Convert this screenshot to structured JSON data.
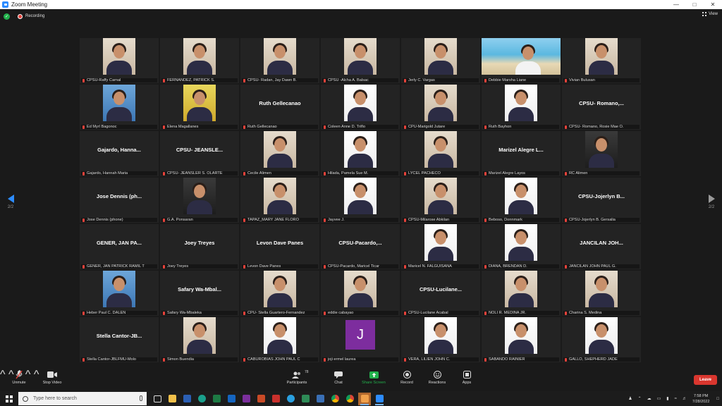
{
  "window": {
    "title": "Zoom Meeting"
  },
  "topbar": {
    "recording_label": "Recording",
    "view_label": "View"
  },
  "pager": {
    "left_label": "2/2",
    "right_label": "2/2"
  },
  "participants": [
    {
      "label": "CPSU-Raffy Carnal",
      "name_display": "",
      "video": "photo"
    },
    {
      "label": "FERNANDEZ, PATRICK S.",
      "name_display": "",
      "video": "photo"
    },
    {
      "label": "CPSU- Radan, Jay Dawn B.",
      "name_display": "",
      "video": "photo"
    },
    {
      "label": "CPSU -Alcha A. Balsac",
      "name_display": "",
      "video": "photo"
    },
    {
      "label": "Jerly C. Vargas",
      "name_display": "",
      "video": "photo"
    },
    {
      "label": "Debbie Marsha Liane",
      "name_display": "",
      "video": "wide"
    },
    {
      "label": "Vivian Bulusan",
      "name_display": "",
      "video": "photo"
    },
    {
      "label": "Ed Myrl Bagonoc",
      "name_display": "",
      "video": "blue"
    },
    {
      "label": "Elena Magallanes",
      "name_display": "",
      "video": "green"
    },
    {
      "label": "Ruth Gellecanao",
      "name_display": "Ruth Gellecanao",
      "video": "none"
    },
    {
      "label": "Coleen Anne D. Triño",
      "name_display": "",
      "video": "white"
    },
    {
      "label": "CPU-Marigold Jutare",
      "name_display": "",
      "video": "photo"
    },
    {
      "label": "Ruth Bayhon",
      "name_display": "",
      "video": "white"
    },
    {
      "label": "CPSU- Romano, Rosie Mae O.",
      "name_display": "CPSU- Romano,...",
      "video": "none"
    },
    {
      "label": "Gajardo, Hannah Maria",
      "name_display": "Gajardo, Hanna...",
      "video": "none"
    },
    {
      "label": "CPSU- JEANSLER S. OLARTE",
      "name_display": "CPSU- JEANSLE...",
      "video": "none"
    },
    {
      "label": "Cecile Alimen",
      "name_display": "",
      "video": "photo"
    },
    {
      "label": "Hilada, Pamela Sue M.",
      "name_display": "",
      "video": "white"
    },
    {
      "label": "LYCEL PACHECO",
      "name_display": "",
      "video": "photo"
    },
    {
      "label": "Marizel Alegre Layos",
      "name_display": "Marizel Alegre L...",
      "video": "none"
    },
    {
      "label": "RC Alimen",
      "name_display": "",
      "video": "dark"
    },
    {
      "label": "Jose Dennis (phone)",
      "name_display": "Jose Dennis (ph...",
      "video": "none"
    },
    {
      "label": "G.A. Ponsaran",
      "name_display": "",
      "video": "dark"
    },
    {
      "label": "TAPAZ_MARY JANE FLORO",
      "name_display": "",
      "video": "photo"
    },
    {
      "label": "Jayvee J.",
      "name_display": "",
      "video": "white"
    },
    {
      "label": "CPSU-Milarose Abkilan",
      "name_display": "",
      "video": "photo"
    },
    {
      "label": "Beboso, Donnmark",
      "name_display": "",
      "video": "white"
    },
    {
      "label": "CPSU-Jojerlyn B. Gersalia",
      "name_display": "CPSU-Jojerlyn B...",
      "video": "none"
    },
    {
      "label": "GENER, JAN PATRICK RAMIL T",
      "name_display": "GENER, JAN PA...",
      "video": "none"
    },
    {
      "label": "Joey Treyes",
      "name_display": "Joey Treyes",
      "video": "none"
    },
    {
      "label": "Levon Dave Panes",
      "name_display": "Levon Dave Panes",
      "video": "none"
    },
    {
      "label": "CPSU-Pacardo, Maricel Ticar",
      "name_display": "CPSU-Pacardo,...",
      "video": "none"
    },
    {
      "label": "Maricel N. FALGUISANA",
      "name_display": "",
      "video": "white"
    },
    {
      "label": "DIANA, BRENDAN D.",
      "name_display": "",
      "video": "white"
    },
    {
      "label": "JANCILAN JOHN PAUL G.",
      "name_display": "JANCILAN JOH...",
      "video": "none"
    },
    {
      "label": "Heber Paul C. DALEN",
      "name_display": "",
      "video": "blue"
    },
    {
      "label": "Safary Wa-Mbaleka",
      "name_display": "Safary Wa-Mbal...",
      "video": "none"
    },
    {
      "label": "CPU- Stella Guartero-Fernandez",
      "name_display": "",
      "video": "photo"
    },
    {
      "label": "eddie cabayao",
      "name_display": "",
      "video": "photo"
    },
    {
      "label": "CPSU-Lucilane Acabal",
      "name_display": "CPSU-Lucilane...",
      "video": "none"
    },
    {
      "label": "NOLI R. MEDINA JR.",
      "name_display": "",
      "video": "photo"
    },
    {
      "label": "Charina S. Medina",
      "name_display": "",
      "video": "photo"
    },
    {
      "label": "Stella Cantor-JBLFMU-Molo",
      "name_display": "Stella Cantor-JB...",
      "video": "none"
    },
    {
      "label": "Simon Buendia",
      "name_display": "",
      "video": "photo"
    },
    {
      "label": "CABUROBIAS JOHN PAUL C",
      "name_display": "",
      "video": "white"
    },
    {
      "label": "joji ermel laurea",
      "name_display": "",
      "video": "avatar",
      "avatar_letter": "J"
    },
    {
      "label": "VERA, LILIEN JOHN C.",
      "name_display": "",
      "video": "white"
    },
    {
      "label": "SABANDO RAINIER",
      "name_display": "",
      "video": "white"
    },
    {
      "label": "GALLO, SHEPHERD JADE",
      "name_display": "",
      "video": "white"
    }
  ],
  "toolbar": {
    "unmute": "Unmute",
    "stop_video": "Stop Video",
    "participants": "Participants",
    "participants_count": "78",
    "chat": "Chat",
    "share_screen": "Share Screen",
    "record": "Record",
    "reactions": "Reactions",
    "apps": "Apps",
    "leave": "Leave"
  },
  "taskbar": {
    "search_placeholder": "Type here to search",
    "time": "7:58 PM",
    "date": "7/28/2022"
  },
  "colors": {
    "accent": "#2d8cff",
    "leave": "#d9362e",
    "share": "#22b14c",
    "mic_muted": "#e8423a"
  }
}
